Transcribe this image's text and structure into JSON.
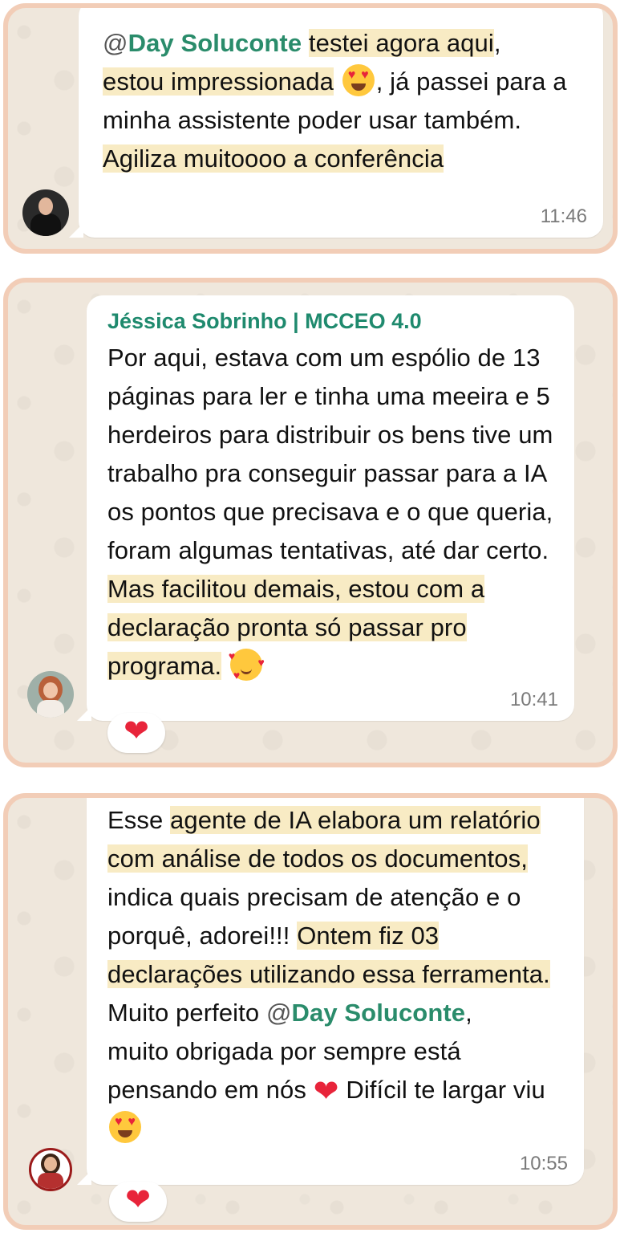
{
  "messages": [
    {
      "segments": [
        "@",
        "Day Soluconte",
        "testei agora aqui",
        ",",
        "estou impressionada",
        ", já passei para a minha assistente poder usar também. ",
        "Agiliza muitoooo a conferência"
      ],
      "time": "11:46"
    },
    {
      "sender": "Jéssica Sobrinho | MCCEO 4.0",
      "segments": [
        "Por aqui, estava com um espólio de 13 páginas para ler e tinha uma meeira e 5 herdeiros para distribuir os bens tive um trabalho pra conseguir passar para a IA os pontos que precisava e o que queria, foram algumas tentativas, até dar certo. ",
        "Mas facilitou demais, estou com a declaração pronta só passar pro programa."
      ],
      "time": "10:41"
    },
    {
      "segments": [
        "Esse ",
        "agente de IA elabora um relatório com análise de todos os documentos,",
        " indica quais precisam de atenção e o porquê, adorei!!! ",
        "Ontem fiz 03 declarações utilizando essa ferramenta.",
        "Muito perfeito ",
        "@",
        "Day Soluconte",
        ",",
        "muito obrigada por sempre está pensando em nós ",
        " Difícil te largar viu "
      ],
      "time": "10:55"
    }
  ],
  "icons": {
    "heart_eyes": "smiling-face-with-heart-eyes-icon",
    "hearts": "smiling-face-with-hearts-icon",
    "heart": "red-heart-icon"
  },
  "colors": {
    "highlight": "#f8ebc4",
    "mention": "#2a8c6b",
    "sender": "#1f8a6e",
    "frame": "#f2cdb7"
  }
}
